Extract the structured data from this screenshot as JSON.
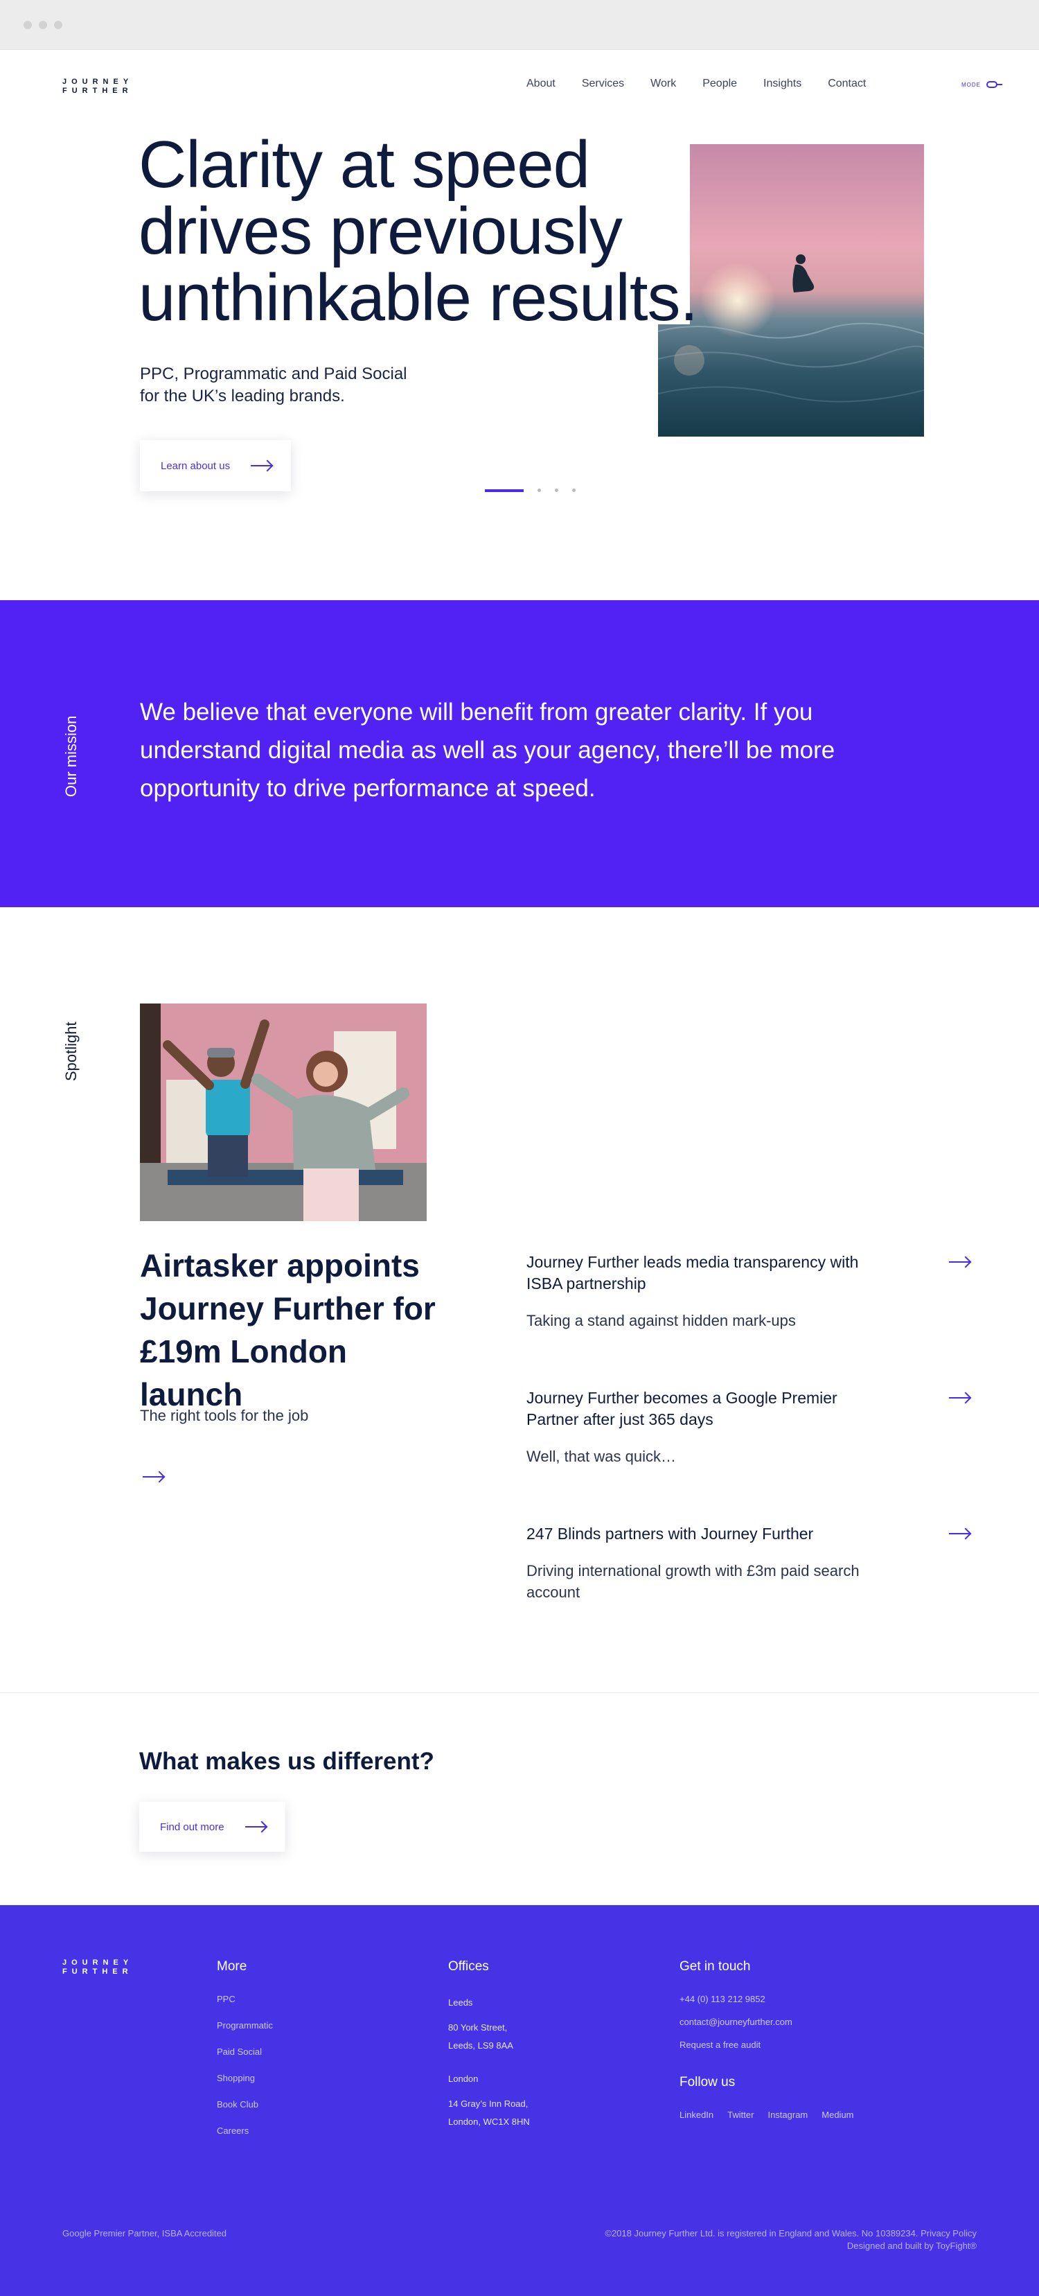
{
  "browser": {
    "window_title": ""
  },
  "header": {
    "logo_line1": "JOURNEY",
    "logo_line2": "FURTHER",
    "nav": [
      "About",
      "Services",
      "Work",
      "People",
      "Insights",
      "Contact"
    ],
    "mode_label": "MODE"
  },
  "hero": {
    "title_line1": "Clarity at speed",
    "title_line2": "drives previously",
    "title_line3": "unthinkable results.",
    "subtitle_line1": "PPC, Programmatic and Paid Social",
    "subtitle_line2": "for the UK’s leading brands.",
    "cta_label": "Learn about us",
    "slide_count": 4,
    "active_slide": 1
  },
  "mission": {
    "label": "Our mission",
    "text": "We believe that everyone will benefit from greater clarity. If you understand digital media as well as your agency, there’ll be more opportunity to drive performance at speed."
  },
  "spotlight": {
    "label": "Spotlight",
    "featured": {
      "title": "Airtasker appoints Journey Further for £19m London launch",
      "subtitle": "The right tools for the job"
    },
    "stories": [
      {
        "title": "Journey Further leads media transparency with ISBA partnership",
        "desc": "Taking a stand against hidden mark-ups"
      },
      {
        "title": "Journey Further becomes a Google Premier Partner after just 365 days",
        "desc": "Well, that was quick…"
      },
      {
        "title": "247 Blinds partners with Journey Further",
        "desc": "Driving international growth with £3m paid search account"
      }
    ]
  },
  "different": {
    "title": "What makes us different?",
    "cta_label": "Find out more"
  },
  "footer": {
    "logo_line1": "JOURNEY",
    "logo_line2": "FURTHER",
    "more": {
      "heading": "More",
      "links": [
        "PPC",
        "Programmatic",
        "Paid Social",
        "Shopping",
        "Book Club",
        "Careers"
      ]
    },
    "offices": {
      "heading": "Offices",
      "leeds_label": "Leeds",
      "leeds_line1": "80 York Street,",
      "leeds_line2": "Leeds, LS9 8AA",
      "london_label": "London",
      "london_line1": "14 Gray’s Inn Road,",
      "london_line2": "London, WC1X 8HN"
    },
    "contact": {
      "heading": "Get in touch",
      "phone": "+44 (0) 113 212 9852",
      "email": "contact@journeyfurther.com",
      "audit": "Request a free audit",
      "follow_heading": "Follow us",
      "social": [
        "LinkedIn",
        "Twitter",
        "Instagram",
        "Medium"
      ]
    },
    "accreditation": "Google Premier Partner, ISBA Accredited",
    "legal_line1": "©2018 Journey Further Ltd. is registered in England and Wales. No 10389234. Privacy Policy",
    "legal_line2": "Designed and built by ToyFight®"
  },
  "colors": {
    "accent": "#5222f5",
    "footer": "#4733e6",
    "navy": "#0f1b3d"
  }
}
